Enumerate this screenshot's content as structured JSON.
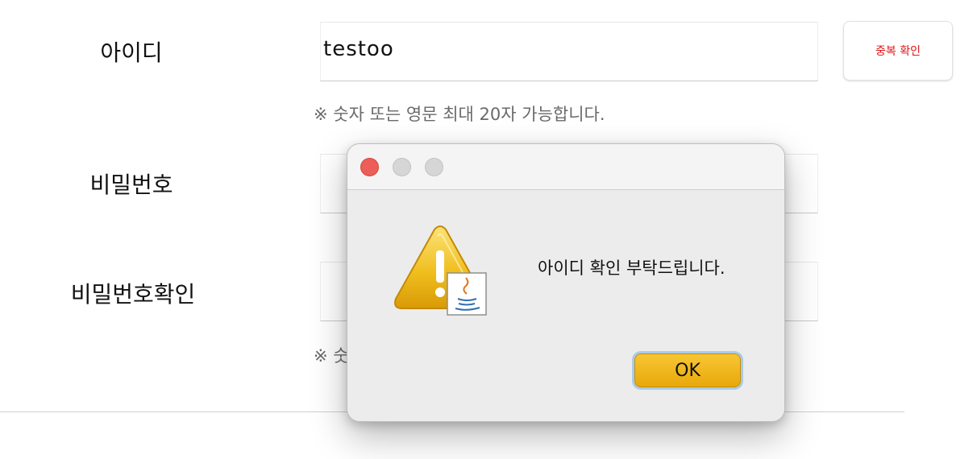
{
  "form": {
    "id_label": "아이디",
    "id_value": "testoo",
    "dup_check_button": "중복 확인",
    "id_hint": "※ 숫자 또는 영문 최대 20자 가능합니다.",
    "password_label": "비밀번호",
    "password_confirm_label": "비밀번호확인",
    "password_hint_partial": "※ 숫",
    "accent_red": "#e01515"
  },
  "dialog": {
    "icon": "warning-java-icon",
    "message": "아이디 확인 부탁드립니다.",
    "ok_label": "OK",
    "ok_color": "#f0b71a"
  }
}
